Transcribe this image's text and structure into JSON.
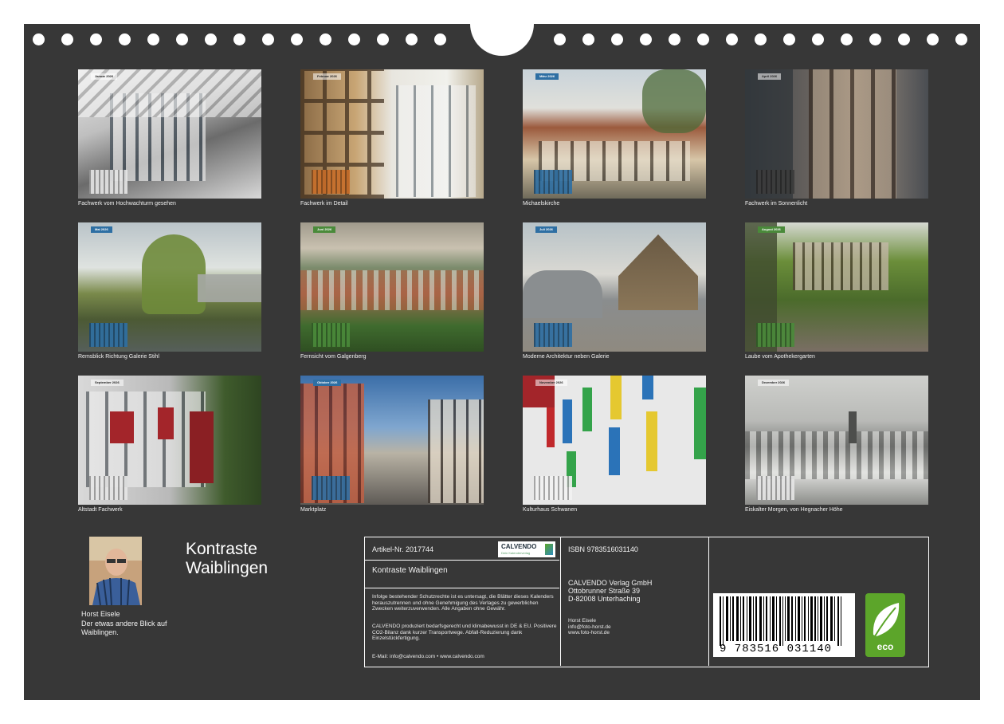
{
  "calendar_title": "Kontraste\nWaiblingen",
  "months": [
    {
      "tag": "Januar 2026",
      "caption": "Fachwerk vom Hochwachturm gesehen"
    },
    {
      "tag": "Februar 2026",
      "caption": "Fachwerk im Detail"
    },
    {
      "tag": "März 2026",
      "caption": "Michaelskirche"
    },
    {
      "tag": "April 2026",
      "caption": "Fachwerk im Sonnenlicht"
    },
    {
      "tag": "Mai 2026",
      "caption": "Remsblick Richtung Galerie Stihl"
    },
    {
      "tag": "Juni 2026",
      "caption": "Fernsicht vom Galgenberg"
    },
    {
      "tag": "Juli 2026",
      "caption": "Moderne Architektur neben Galerie"
    },
    {
      "tag": "August 2026",
      "caption": "Laube vom Apothekergarten"
    },
    {
      "tag": "September 2026",
      "caption": "Altstadt Fachwerk"
    },
    {
      "tag": "Oktober 2026",
      "caption": "Marktplatz"
    },
    {
      "tag": "November 2026",
      "caption": "Kulturhaus Schwanen"
    },
    {
      "tag": "Dezember 2026",
      "caption": "Eiskalter Morgen, von Hegnacher Höhe"
    }
  ],
  "author": {
    "name": "Horst Eisele",
    "description": "Der etwas andere Blick auf Waiblingen."
  },
  "info": {
    "article_no": "Artikel-Nr. 2017744",
    "product_title": "Kontraste Waiblingen",
    "legal": "Infolge bestehender Schutzrechte ist es untersagt, die Blätter dieses Kalenders herauszutrennen und ohne Genehmigung des Verlages zu gewerblichen Zwecken weiterzuverwenden. Alle Angaben ohne Gewähr.",
    "eco_text": "CALVENDO produziert bedarfsgerecht und klimabewusst in DE & EU. Positivere CO2-Bilanz dank kurzer Transportwege. Abfall-Reduzierung dank Einzelstückfertigung.",
    "email": "E-Mail: info@calvendo.com • www.calvendo.com",
    "isbn": "ISBN 9783516031140",
    "publisher_lines": [
      "CALVENDO Verlag GmbH",
      "Ottobrunner Straße 39",
      "D-82008 Unterhaching"
    ],
    "author_contact": [
      "Horst Eisele",
      "info@foto-horst.de",
      "www.foto-horst.de"
    ],
    "calvendo_logo": "CALVENDO",
    "calvendo_sub": "Dein Kalenderverlag",
    "barcode_text": "9 783516 031140",
    "eco_label": "eco"
  }
}
